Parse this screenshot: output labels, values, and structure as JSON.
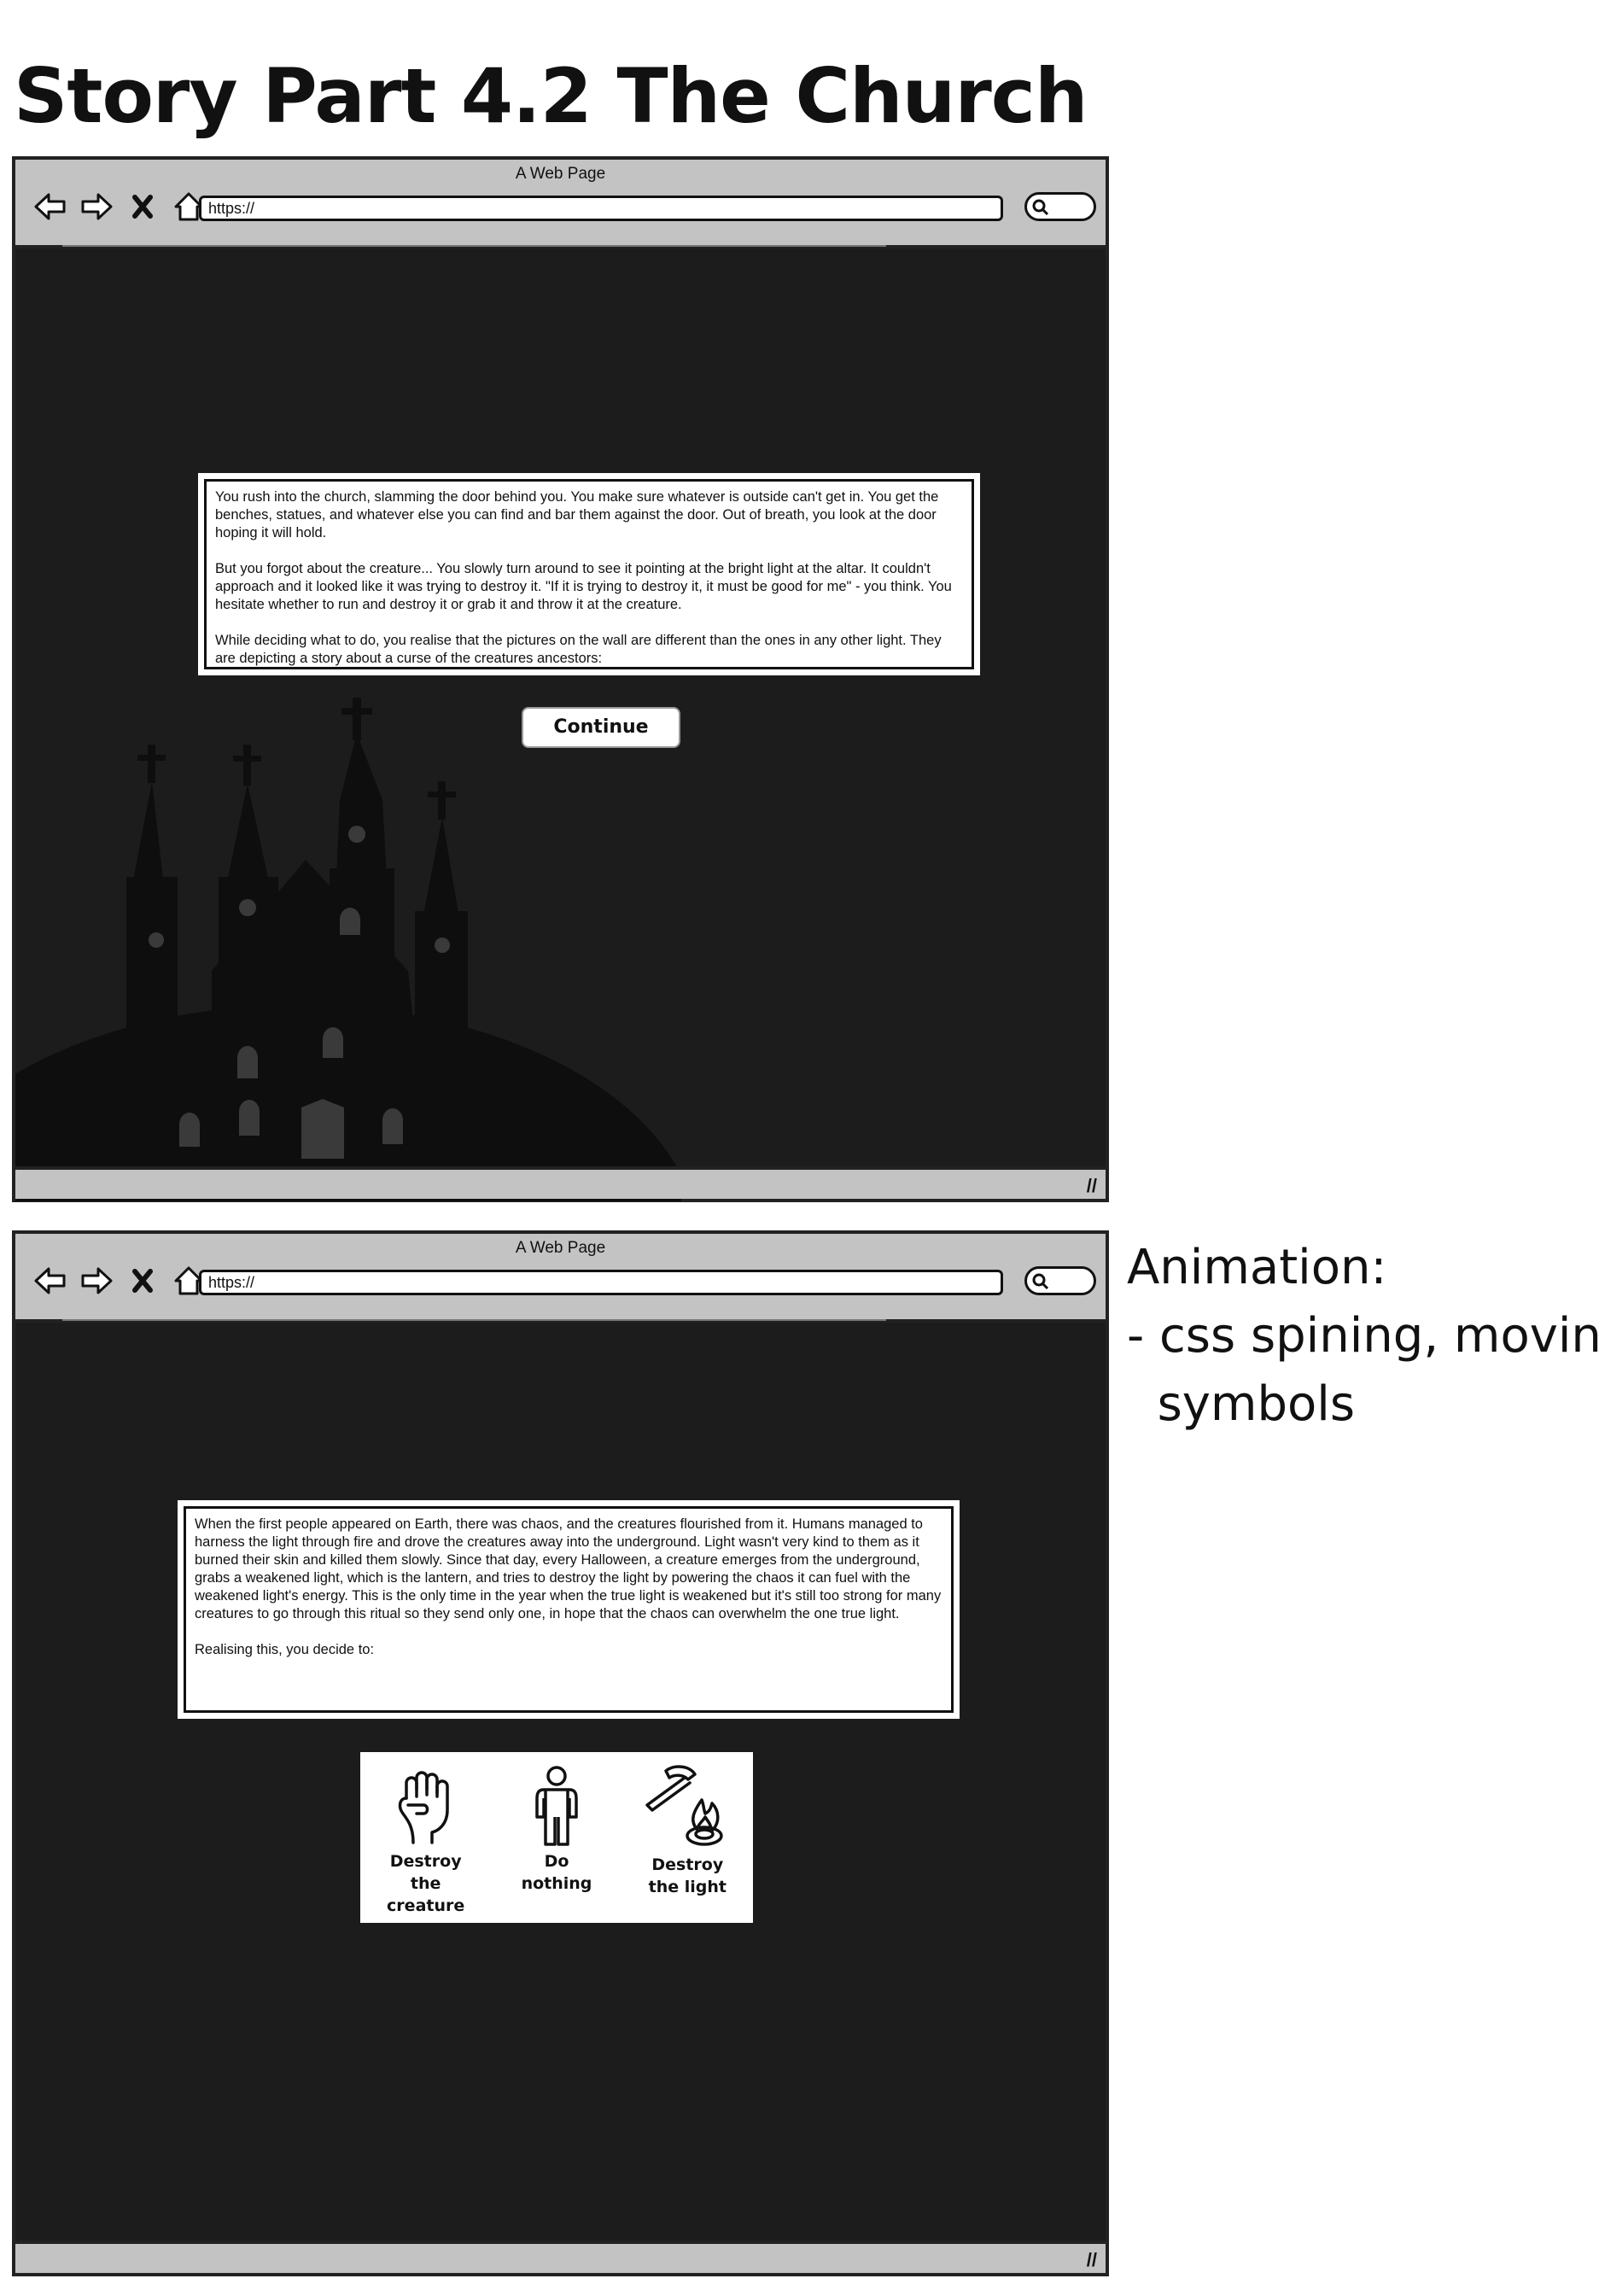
{
  "page_title": "Story Part 4.2 The Church",
  "browsers": [
    {
      "window_title": "A Web Page",
      "url": "https://",
      "panel": {
        "paragraphs": [
          "You rush into the church, slamming the door behind you. You make sure whatever is outside can't get in. You get the benches, statues, and whatever else you can find and bar them against the door. Out of breath, you look at the door hoping it will hold.",
          "But you forgot about the creature... You slowly turn around to see it pointing at the bright light at the altar. It couldn't approach and it looked like it was trying to destroy it. \"If it is trying to destroy it, it must be good for me\" - you think. You hesitate whether to run and destroy it or grab it and throw it at the creature.",
          "While deciding what to do, you realise that the pictures on the wall are different than the ones in any other light. They are depicting a story about a curse of the creatures ancestors:"
        ]
      },
      "continue_label": "Continue"
    },
    {
      "window_title": "A Web Page",
      "url": "https://",
      "panel": {
        "paragraphs": [
          "When the first people appeared on Earth, there was chaos, and the creatures flourished from it. Humans managed to harness the light through fire and drove the creatures away into the underground. Light wasn't very kind to them as it burned their skin and killed them slowly. Since that day, every Halloween, a creature emerges from the underground, grabs a weakened light, which is the lantern, and tries to destroy the light by powering the chaos it can fuel with the weakened light's energy. This is the only time in the year when the true light is weakened but it's still too strong for many creatures to go through this ritual so they send only one, in hope that the chaos can overwhelm the one true light.",
          "Realising this, you decide to:"
        ]
      },
      "choices": [
        {
          "line1": "Destroy",
          "line2": "the creature",
          "icon": "fist-icon"
        },
        {
          "line1": "Do",
          "line2": "nothing",
          "icon": "person-icon"
        },
        {
          "line1": "Destroy",
          "line2": "the light",
          "icon": "hammer-fire-icon"
        }
      ]
    }
  ],
  "animation_note": {
    "line1": "Animation:",
    "line2": "- css spining, moving",
    "line3": "  symbols"
  },
  "colors": {
    "screen_bg": "#1c1c1c",
    "chrome_bg": "#c3c3c3",
    "church_silhouette": "#0e0e0e"
  }
}
